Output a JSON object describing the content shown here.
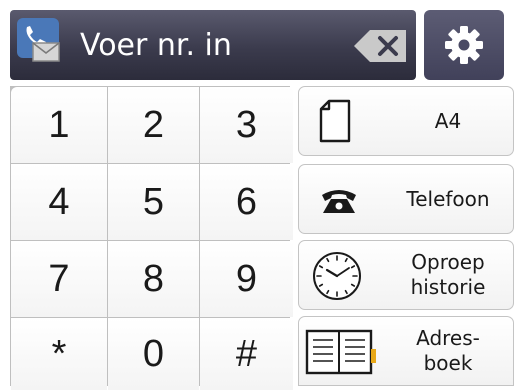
{
  "header": {
    "fax_icon": "fax-envelope-icon",
    "number_placeholder": "Voer nr. in",
    "backspace_icon": "backspace-icon",
    "settings_icon": "gear-icon"
  },
  "keypad": {
    "keys": [
      "1",
      "2",
      "3",
      "4",
      "5",
      "6",
      "7",
      "8",
      "9",
      "*",
      "0",
      "#"
    ]
  },
  "side_buttons": {
    "paper": {
      "label": "A4",
      "icon": "paper-sheet-icon"
    },
    "phone": {
      "label": "Telefoon",
      "icon": "telephone-icon"
    },
    "history": {
      "line1": "Oproep",
      "line2": "historie",
      "icon": "clock-icon"
    },
    "address_book": {
      "line1": "Adres-",
      "line2": "boek",
      "icon": "address-book-icon"
    }
  },
  "colors": {
    "header_bg": "#3b3b4d",
    "settings_bg": "#4a4a64",
    "fax_icon_bg": "#4a78b8",
    "address_book_accent": "#e8a818"
  }
}
